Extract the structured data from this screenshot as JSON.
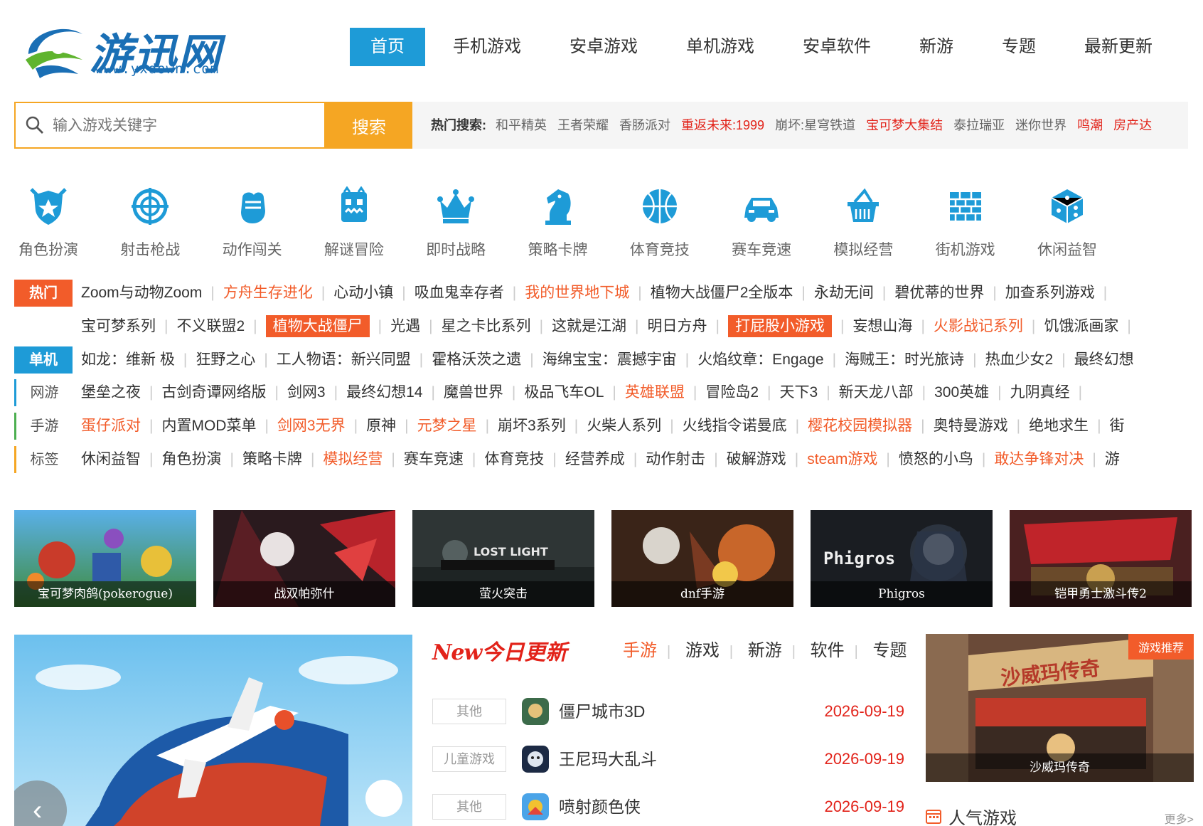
{
  "header": {
    "logo_text": "游迅网",
    "logo_url": "www.yxdown.com",
    "nav": [
      "首页",
      "手机游戏",
      "安卓游戏",
      "单机游戏",
      "安卓软件",
      "新游",
      "专题",
      "最新更新"
    ]
  },
  "search": {
    "placeholder": "输入游戏关键字",
    "button": "搜索",
    "hot_label": "热门搜索:",
    "hot": [
      {
        "text": "和平精英",
        "red": false
      },
      {
        "text": "王者荣耀",
        "red": false
      },
      {
        "text": "香肠派对",
        "red": false
      },
      {
        "text": "重返未来:1999",
        "red": true
      },
      {
        "text": "崩坏:星穹铁道",
        "red": false
      },
      {
        "text": "宝可梦大集结",
        "red": true
      },
      {
        "text": "泰拉瑞亚",
        "red": false
      },
      {
        "text": "迷你世界",
        "red": false
      },
      {
        "text": "鸣潮",
        "red": true
      },
      {
        "text": "房产达",
        "red": true
      }
    ]
  },
  "categories": [
    {
      "label": "角色扮演",
      "icon": "shield-star-icon"
    },
    {
      "label": "射击枪战",
      "icon": "crosshair-icon"
    },
    {
      "label": "动作闯关",
      "icon": "fist-icon"
    },
    {
      "label": "解谜冒险",
      "icon": "monster-icon"
    },
    {
      "label": "即时战略",
      "icon": "crown-icon"
    },
    {
      "label": "策略卡牌",
      "icon": "chess-knight-icon"
    },
    {
      "label": "体育竞技",
      "icon": "basketball-icon"
    },
    {
      "label": "赛车竞速",
      "icon": "car-icon"
    },
    {
      "label": "模拟经营",
      "icon": "basket-icon"
    },
    {
      "label": "街机游戏",
      "icon": "brick-wall-icon"
    },
    {
      "label": "休闲益智",
      "icon": "dice-icon"
    }
  ],
  "tag_rows": [
    {
      "label": "热门",
      "style": "hot",
      "items": [
        {
          "t": "Zoom与动物Zoom",
          "s": ""
        },
        {
          "t": "方舟生存进化",
          "s": "o"
        },
        {
          "t": "心动小镇",
          "s": ""
        },
        {
          "t": "吸血鬼幸存者",
          "s": ""
        },
        {
          "t": "我的世界地下城",
          "s": "o"
        },
        {
          "t": "植物大战僵尸2全版本",
          "s": ""
        },
        {
          "t": "永劫无间",
          "s": ""
        },
        {
          "t": "碧优蒂的世界",
          "s": ""
        },
        {
          "t": "加查系列游戏",
          "s": ""
        }
      ]
    },
    {
      "label": "",
      "style": "none",
      "items": [
        {
          "t": "宝可梦系列",
          "s": ""
        },
        {
          "t": "不义联盟2",
          "s": ""
        },
        {
          "t": "植物大战僵尸",
          "s": "hl"
        },
        {
          "t": "光遇",
          "s": ""
        },
        {
          "t": "星之卡比系列",
          "s": ""
        },
        {
          "t": "这就是江湖",
          "s": ""
        },
        {
          "t": "明日方舟",
          "s": ""
        },
        {
          "t": "打屁股小游戏",
          "s": "hl"
        },
        {
          "t": "妄想山海",
          "s": ""
        },
        {
          "t": "火影战记系列",
          "s": "o"
        },
        {
          "t": "饥饿派画家",
          "s": ""
        }
      ]
    },
    {
      "label": "单机",
      "style": "dan",
      "items": [
        {
          "t": "如龙：维新 极",
          "s": ""
        },
        {
          "t": "狂野之心",
          "s": ""
        },
        {
          "t": "工人物语：新兴同盟",
          "s": ""
        },
        {
          "t": "霍格沃茨之遗",
          "s": ""
        },
        {
          "t": "海绵宝宝：震撼宇宙",
          "s": ""
        },
        {
          "t": "火焰纹章：Engage",
          "s": ""
        },
        {
          "t": "海贼王：时光旅诗",
          "s": ""
        },
        {
          "t": "热血少女2",
          "s": ""
        },
        {
          "t": "最终幻想",
          "s": ""
        }
      ]
    },
    {
      "label": "网游",
      "style": "line b",
      "items": [
        {
          "t": "堡垒之夜",
          "s": ""
        },
        {
          "t": "古剑奇谭网络版",
          "s": ""
        },
        {
          "t": "剑网3",
          "s": ""
        },
        {
          "t": "最终幻想14",
          "s": ""
        },
        {
          "t": "魔兽世界",
          "s": ""
        },
        {
          "t": "极品飞车OL",
          "s": ""
        },
        {
          "t": "英雄联盟",
          "s": "o"
        },
        {
          "t": "冒险岛2",
          "s": ""
        },
        {
          "t": "天下3",
          "s": ""
        },
        {
          "t": "新天龙八部",
          "s": ""
        },
        {
          "t": "300英雄",
          "s": ""
        },
        {
          "t": "九阴真经",
          "s": ""
        }
      ]
    },
    {
      "label": "手游",
      "style": "line g",
      "items": [
        {
          "t": "蛋仔派对",
          "s": "o"
        },
        {
          "t": "内置MOD菜单",
          "s": ""
        },
        {
          "t": "剑网3无界",
          "s": "o"
        },
        {
          "t": "原神",
          "s": ""
        },
        {
          "t": "元梦之星",
          "s": "o"
        },
        {
          "t": "崩坏3系列",
          "s": ""
        },
        {
          "t": "火柴人系列",
          "s": ""
        },
        {
          "t": "火线指令诺曼底",
          "s": ""
        },
        {
          "t": "樱花校园模拟器",
          "s": "o"
        },
        {
          "t": "奥特曼游戏",
          "s": ""
        },
        {
          "t": "绝地求生",
          "s": ""
        },
        {
          "t": "街",
          "s": ""
        }
      ]
    },
    {
      "label": "标签",
      "style": "line o",
      "items": [
        {
          "t": "休闲益智",
          "s": ""
        },
        {
          "t": "角色扮演",
          "s": ""
        },
        {
          "t": "策略卡牌",
          "s": ""
        },
        {
          "t": "模拟经营",
          "s": "o"
        },
        {
          "t": "赛车竞速",
          "s": ""
        },
        {
          "t": "体育竞技",
          "s": ""
        },
        {
          "t": "经营养成",
          "s": ""
        },
        {
          "t": "动作射击",
          "s": ""
        },
        {
          "t": "破解游戏",
          "s": ""
        },
        {
          "t": "steam游戏",
          "s": "o"
        },
        {
          "t": "愤怒的小鸟",
          "s": ""
        },
        {
          "t": "敢达争锋对决",
          "s": "o"
        },
        {
          "t": "游",
          "s": ""
        }
      ]
    }
  ],
  "thumbnails": [
    {
      "caption": "宝可梦肉鸽(pokerogue)"
    },
    {
      "caption": "战双帕弥什"
    },
    {
      "caption": "萤火突击"
    },
    {
      "caption": "dnf手游"
    },
    {
      "caption": "Phigros",
      "overlay": "Phigros"
    },
    {
      "caption": "铠甲勇士激斗传2"
    }
  ],
  "today": {
    "title_new": "New",
    "title": "今日更新",
    "tabs": [
      "手游",
      "游戏",
      "新游",
      "软件",
      "专题"
    ],
    "rows": [
      {
        "type": "其他",
        "name": "僵尸城市3D",
        "date": "2026-09-19"
      },
      {
        "type": "儿童游戏",
        "name": "王尼玛大乱斗",
        "date": "2026-09-19"
      },
      {
        "type": "其他",
        "name": "喷射颜色侠",
        "date": "2026-09-19"
      }
    ]
  },
  "banner": {
    "prev": "‹"
  },
  "recommend": {
    "tag": "游戏推荐",
    "caption": "沙威玛传奇",
    "sign": "沙威玛传奇"
  },
  "popular": {
    "title": "人气游戏",
    "more": "更多>"
  },
  "colors": {
    "accent_blue": "#1e9bd7",
    "accent_orange": "#f5a623",
    "hot_red": "#f25c2a",
    "date_red": "#e2231a"
  }
}
